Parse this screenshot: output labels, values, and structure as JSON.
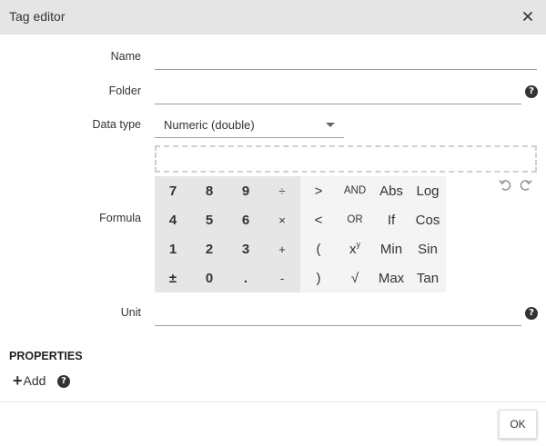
{
  "dialog": {
    "title": "Tag editor"
  },
  "fields": {
    "name_label": "Name",
    "name_value": "",
    "folder_label": "Folder",
    "folder_value": "",
    "datatype_label": "Data type",
    "datatype_value": "Numeric (double)",
    "formula_label": "Formula",
    "formula_value": "",
    "unit_label": "Unit",
    "unit_value": ""
  },
  "keypad": {
    "k7": "7",
    "k8": "8",
    "k9": "9",
    "div": "÷",
    "gt": ">",
    "and": "AND",
    "abs": "Abs",
    "log": "Log",
    "k4": "4",
    "k5": "5",
    "k6": "6",
    "mul": "×",
    "lt": "<",
    "or": "OR",
    "if": "If",
    "cos": "Cos",
    "k1": "1",
    "k2": "2",
    "k3": "3",
    "plus": "+",
    "lparen": "(",
    "pow_base": "x",
    "pow_exp": "y",
    "min": "Min",
    "sin": "Sin",
    "pm": "±",
    "k0": "0",
    "dot": ".",
    "minus": "-",
    "rparen": ")",
    "sqrt": "√",
    "max": "Max",
    "tan": "Tan"
  },
  "help_glyph": "?",
  "properties": {
    "title": "PROPERTIES",
    "add_plus": "+",
    "add_label": "Add"
  },
  "footer": {
    "ok_label": "OK"
  },
  "icons": {
    "close": "close-icon",
    "help": "help-circle-icon",
    "undo": "undo-icon",
    "redo": "redo-icon",
    "caret": "caret-down-icon",
    "plus": "plus-icon"
  }
}
